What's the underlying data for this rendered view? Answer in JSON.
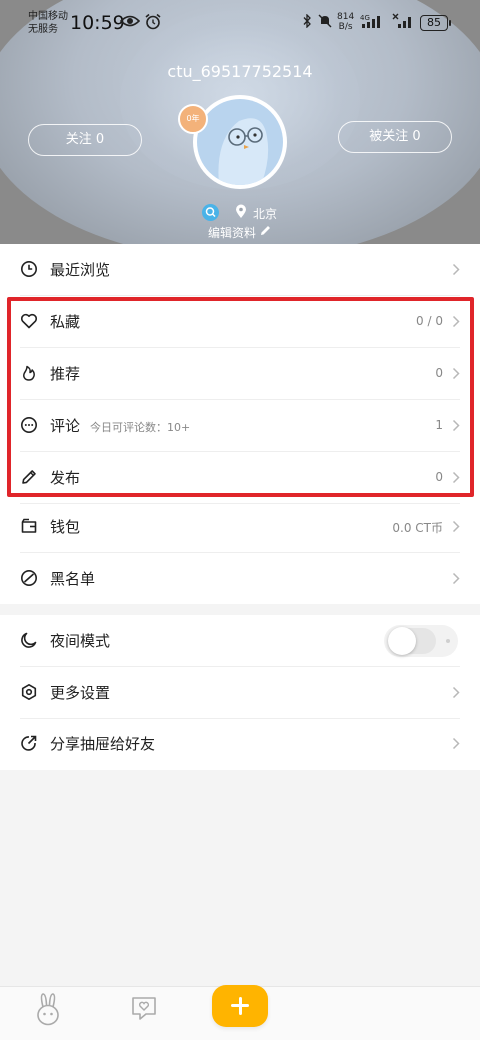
{
  "status_bar": {
    "carrier_line1": "中国移动",
    "carrier_line2": "无服务",
    "time": "10:59",
    "net_speed_value": "814",
    "net_speed_unit": "B/s",
    "network": "4G",
    "battery": "85"
  },
  "profile": {
    "username": "ctu_69517752514",
    "following_label": "关注 0",
    "followers_label": "被关注 0",
    "age_badge": "0年",
    "city": "北京",
    "edit_label": "编辑资料"
  },
  "menu_group_1": [
    {
      "label": "最近浏览",
      "value": "",
      "sub": "",
      "icon": "clock-icon"
    },
    {
      "label": "私藏",
      "value": "0 / 0",
      "sub": "",
      "icon": "heart-icon"
    },
    {
      "label": "推荐",
      "value": "0",
      "sub": "",
      "icon": "flame-icon"
    },
    {
      "label": "评论",
      "value": "1",
      "sub": "今日可评论数：10+",
      "icon": "comment-icon"
    },
    {
      "label": "发布",
      "value": "0",
      "sub": "",
      "icon": "pencil-icon"
    },
    {
      "label": "钱包",
      "value": "0.0 CT币",
      "sub": "",
      "icon": "wallet-icon"
    },
    {
      "label": "黑名单",
      "value": "",
      "sub": "",
      "icon": "block-icon"
    }
  ],
  "menu_group_2": [
    {
      "label": "夜间模式",
      "toggle": false,
      "icon": "moon-icon"
    },
    {
      "label": "更多设置",
      "icon": "settings-icon"
    },
    {
      "label": "分享抽屉给好友",
      "icon": "share-icon"
    }
  ],
  "colors": {
    "highlight": "#e0252a",
    "accent": "#ffb400"
  }
}
